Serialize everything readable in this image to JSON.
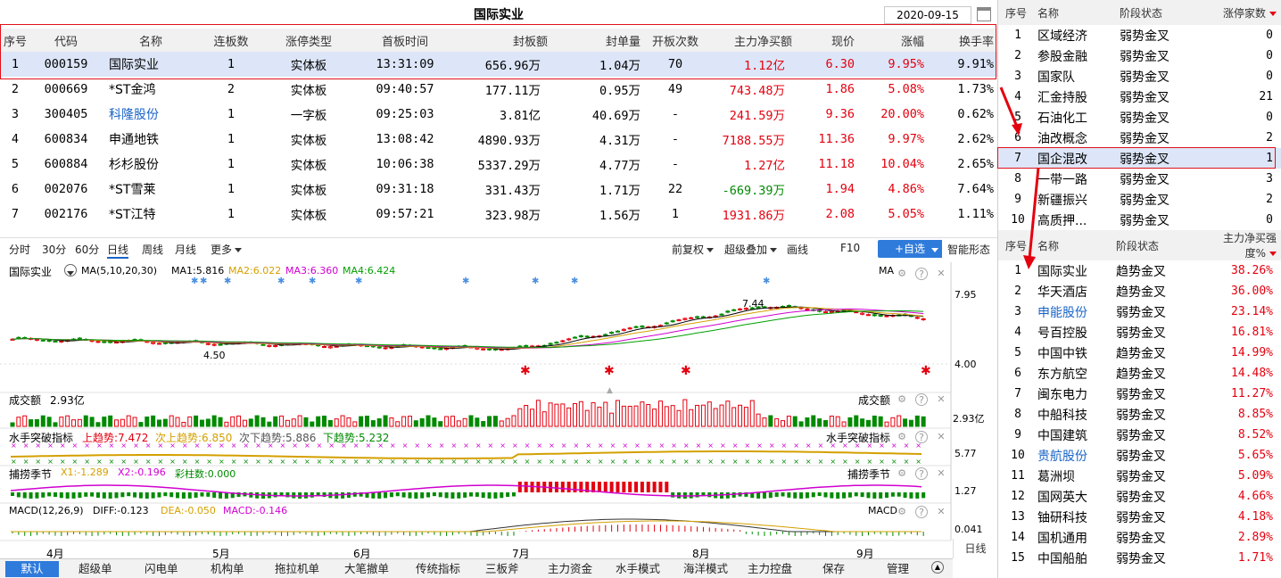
{
  "header": {
    "title": "国际实业",
    "date": "2020-09-15"
  },
  "main_table": {
    "columns": [
      "序号",
      "代码",
      "名称",
      "连板数",
      "涨停类型",
      "首板时间",
      "封板额",
      "封单量",
      "开板次数",
      "主力净买额",
      "现价",
      "涨幅",
      "换手率"
    ],
    "rows": [
      {
        "idx": "1",
        "code": "000159",
        "name": "国际实业",
        "lb": "1",
        "type": "实体板",
        "time": "13:31:09",
        "amt": "656.96万",
        "vol": "1.04万",
        "open": "70",
        "net": "1.12亿",
        "price": "6.30",
        "chg": "9.95%",
        "turn": "9.91%",
        "net_color": "red",
        "chg_color": "red"
      },
      {
        "idx": "2",
        "code": "000669",
        "name": "*ST金鸿",
        "lb": "2",
        "type": "实体板",
        "time": "09:40:57",
        "amt": "177.11万",
        "vol": "0.95万",
        "open": "49",
        "net": "743.48万",
        "price": "1.86",
        "chg": "5.08%",
        "turn": "1.73%",
        "net_color": "red",
        "chg_color": "red"
      },
      {
        "idx": "3",
        "code": "300405",
        "name": "科隆股份",
        "lb": "1",
        "type": "一字板",
        "time": "09:25:03",
        "amt": "3.81亿",
        "vol": "40.69万",
        "open": "-",
        "net": "241.59万",
        "price": "9.36",
        "chg": "20.00%",
        "turn": "0.62%",
        "net_color": "red",
        "chg_color": "red",
        "name_color": "blue"
      },
      {
        "idx": "4",
        "code": "600834",
        "name": "申通地铁",
        "lb": "1",
        "type": "实体板",
        "time": "13:08:42",
        "amt": "4890.93万",
        "vol": "4.31万",
        "open": "-",
        "net": "7188.55万",
        "price": "11.36",
        "chg": "9.97%",
        "turn": "2.62%",
        "net_color": "red",
        "chg_color": "red"
      },
      {
        "idx": "5",
        "code": "600884",
        "name": "杉杉股份",
        "lb": "1",
        "type": "实体板",
        "time": "10:06:38",
        "amt": "5337.29万",
        "vol": "4.77万",
        "open": "-",
        "net": "1.27亿",
        "price": "11.18",
        "chg": "10.04%",
        "turn": "2.65%",
        "net_color": "red",
        "chg_color": "red"
      },
      {
        "idx": "6",
        "code": "002076",
        "name": "*ST雪莱",
        "lb": "1",
        "type": "实体板",
        "time": "09:31:18",
        "amt": "331.43万",
        "vol": "1.71万",
        "open": "22",
        "net": "-669.39万",
        "price": "1.94",
        "chg": "4.86%",
        "turn": "7.64%",
        "net_color": "green",
        "chg_color": "red"
      },
      {
        "idx": "7",
        "code": "002176",
        "name": "*ST江特",
        "lb": "1",
        "type": "实体板",
        "time": "09:57:21",
        "amt": "323.98万",
        "vol": "1.56万",
        "open": "1",
        "net": "1931.86万",
        "price": "2.08",
        "chg": "5.05%",
        "turn": "1.11%",
        "net_color": "red",
        "chg_color": "red"
      }
    ]
  },
  "toolbar": {
    "tabs": [
      "分时",
      "30分",
      "60分",
      "日线",
      "周线",
      "月线",
      "更多"
    ],
    "active": "日线",
    "fq": "前复权",
    "overlay": "超级叠加",
    "draw": "画线",
    "f10": "F10",
    "add": "+自选",
    "smart": "智能形态"
  },
  "kline": {
    "name": "国际实业",
    "ma_label": "MA(5,10,20,30)",
    "ma1": "MA1:5.816",
    "ma2": "MA2:6.022",
    "ma3": "MA3:6.360",
    "ma4": "MA4:6.424",
    "ma_tag": "MA",
    "high_label": "7.44",
    "low_label": "4.50",
    "axis_top": "7.95",
    "axis_bottom": "4.00",
    "vol_title": "成交额",
    "vol_value": "2.93亿",
    "vol_tag": "成交额",
    "vol_axis": "2.93亿",
    "ind1_name": "水手突破指标",
    "ind1_a": "上趋势:7.472",
    "ind1_b": "次上趋势:6.850",
    "ind1_c": "次下趋势:5.886",
    "ind1_d": "下趋势:5.232",
    "ind1_tag": "水手突破指标",
    "ind1_axis": "5.77",
    "ind2_name": "捕捞季节",
    "ind2_a": "X1:-1.289",
    "ind2_b": "X2:-0.196",
    "ind2_c": "彩柱数:0.000",
    "ind2_tag": "捕捞季节",
    "ind2_axis": "1.27",
    "macd_name": "MACD(12,26,9)",
    "macd_a": "DIFF:-0.123",
    "macd_b": "DEA:-0.050",
    "macd_c": "MACD:-0.146",
    "macd_tag": "MACD",
    "macd_axis": "0.041",
    "months": [
      "4月",
      "5月",
      "6月",
      "7月",
      "8月",
      "9月"
    ],
    "period_label": "日线"
  },
  "bottom_tabs": [
    "默认",
    "超级单",
    "闪电单",
    "机构单",
    "拖拉机单",
    "大笔撤单",
    "传统指标",
    "三板斧",
    "主力资金",
    "水手模式",
    "海洋模式",
    "主力控盘",
    "保存",
    "管理"
  ],
  "sector_table": {
    "columns": [
      "序号",
      "名称",
      "阶段状态",
      "涨停家数"
    ],
    "rows": [
      {
        "idx": "1",
        "name": "区域经济",
        "state": "弱势金叉",
        "cnt": "0"
      },
      {
        "idx": "2",
        "name": "参股金融",
        "state": "弱势金叉",
        "cnt": "0"
      },
      {
        "idx": "3",
        "name": "国家队",
        "state": "弱势金叉",
        "cnt": "0"
      },
      {
        "idx": "4",
        "name": "汇金持股",
        "state": "弱势金叉",
        "cnt": "21"
      },
      {
        "idx": "5",
        "name": "石油化工",
        "state": "弱势金叉",
        "cnt": "0"
      },
      {
        "idx": "6",
        "name": "油改概念",
        "state": "弱势金叉",
        "cnt": "2"
      },
      {
        "idx": "7",
        "name": "国企混改",
        "state": "弱势金叉",
        "cnt": "1"
      },
      {
        "idx": "8",
        "name": "一带一路",
        "state": "弱势金叉",
        "cnt": "3"
      },
      {
        "idx": "9",
        "name": "新疆振兴",
        "state": "弱势金叉",
        "cnt": "2"
      },
      {
        "idx": "10",
        "name": "高质押...",
        "state": "弱势金叉",
        "cnt": "0"
      }
    ]
  },
  "stock_table": {
    "columns": [
      "序号",
      "名称",
      "阶段状态",
      "主力净买强度%"
    ],
    "rows": [
      {
        "idx": "1",
        "name": "国际实业",
        "state": "趋势金叉",
        "pct": "38.26%"
      },
      {
        "idx": "2",
        "name": "华天酒店",
        "state": "趋势金叉",
        "pct": "36.00%"
      },
      {
        "idx": "3",
        "name": "申能股份",
        "state": "弱势金叉",
        "pct": "23.14%",
        "name_color": "blue"
      },
      {
        "idx": "4",
        "name": "号百控股",
        "state": "弱势金叉",
        "pct": "16.81%"
      },
      {
        "idx": "5",
        "name": "中国中铁",
        "state": "趋势金叉",
        "pct": "14.99%"
      },
      {
        "idx": "6",
        "name": "东方航空",
        "state": "趋势金叉",
        "pct": "14.48%"
      },
      {
        "idx": "7",
        "name": "闽东电力",
        "state": "弱势金叉",
        "pct": "11.27%"
      },
      {
        "idx": "8",
        "name": "中船科技",
        "state": "弱势金叉",
        "pct": "8.85%"
      },
      {
        "idx": "9",
        "name": "中国建筑",
        "state": "弱势金叉",
        "pct": "8.52%"
      },
      {
        "idx": "10",
        "name": "贵航股份",
        "state": "弱势金叉",
        "pct": "5.65%",
        "name_color": "blue"
      },
      {
        "idx": "11",
        "name": "葛洲坝",
        "state": "弱势金叉",
        "pct": "5.09%"
      },
      {
        "idx": "12",
        "name": "国网英大",
        "state": "弱势金叉",
        "pct": "4.66%"
      },
      {
        "idx": "13",
        "name": "铀研科技",
        "state": "弱势金叉",
        "pct": "4.18%"
      },
      {
        "idx": "14",
        "name": "国机通用",
        "state": "弱势金叉",
        "pct": "2.89%"
      },
      {
        "idx": "15",
        "name": "中国船舶",
        "state": "弱势金叉",
        "pct": "1.71%"
      }
    ]
  },
  "colors": {
    "up": "#e4000f",
    "down": "#008a00",
    "accent": "#2e7bdb",
    "select": "#dde6f8",
    "ma1": "#000000",
    "ma2": "#d4a000",
    "ma3": "#d000d0",
    "ma4": "#00a000"
  }
}
